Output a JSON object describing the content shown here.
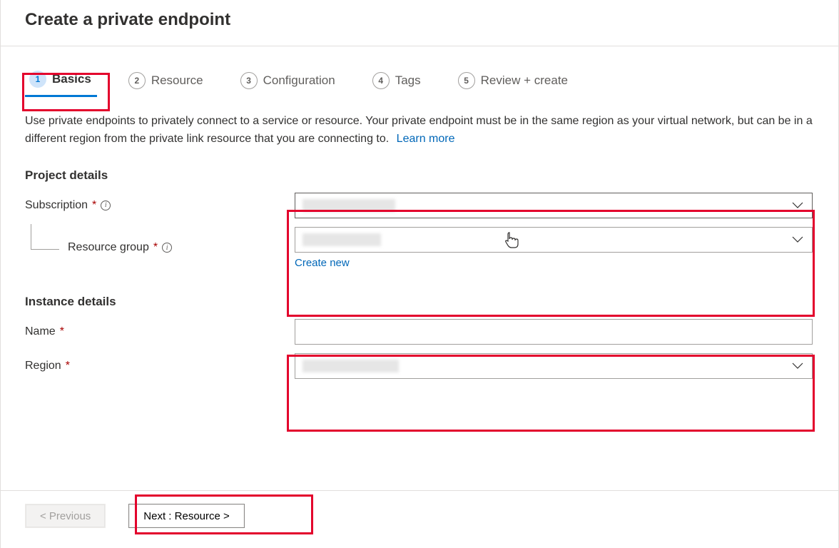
{
  "header": {
    "title": "Create a private endpoint"
  },
  "tabs": [
    {
      "num": "1",
      "label": "Basics"
    },
    {
      "num": "2",
      "label": "Resource"
    },
    {
      "num": "3",
      "label": "Configuration"
    },
    {
      "num": "4",
      "label": "Tags"
    },
    {
      "num": "5",
      "label": "Review + create"
    }
  ],
  "intro": {
    "text": "Use private endpoints to privately connect to a service or resource. Your private endpoint must be in the same region as your virtual network, but can be in a different region from the private link resource that you are connecting to.",
    "learn_more": "Learn more"
  },
  "sections": {
    "project": {
      "title": "Project details",
      "subscription_label": "Subscription",
      "resource_group_label": "Resource group",
      "create_new": "Create new"
    },
    "instance": {
      "title": "Instance details",
      "name_label": "Name",
      "region_label": "Region"
    }
  },
  "footer": {
    "previous": "< Previous",
    "next": "Next : Resource >"
  },
  "required_marker": "*"
}
